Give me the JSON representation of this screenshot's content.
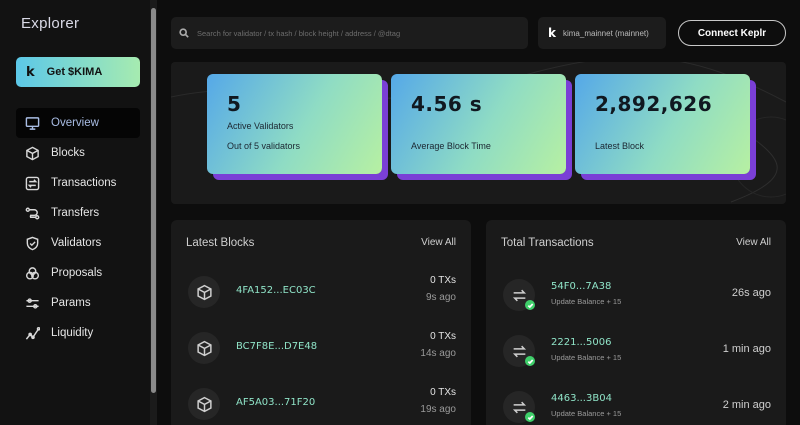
{
  "sidebar": {
    "brand": "Explorer",
    "cta_label": "Get $KIMA",
    "cta_icon": "k-logo-icon",
    "items": [
      {
        "label": "Overview",
        "icon": "monitor-icon",
        "active": true
      },
      {
        "label": "Blocks",
        "icon": "cube-icon"
      },
      {
        "label": "Transactions",
        "icon": "swap-icon"
      },
      {
        "label": "Transfers",
        "icon": "transfer-icon"
      },
      {
        "label": "Validators",
        "icon": "shield-icon"
      },
      {
        "label": "Proposals",
        "icon": "proposals-icon"
      },
      {
        "label": "Params",
        "icon": "sliders-icon"
      },
      {
        "label": "Liquidity",
        "icon": "chart-line-icon"
      }
    ]
  },
  "header": {
    "search_placeholder": "Search for validator / tx hash / block height / address / @dtag",
    "network_label": "kima_mainnet (mainnet)",
    "connect_label": "Connect Keplr"
  },
  "stats": [
    {
      "value": "5",
      "label": "Active Validators",
      "sub": "Out of 5 validators"
    },
    {
      "value": "4.56 s",
      "label": "Average Block Time"
    },
    {
      "value": "2,892,626",
      "label": "Latest Block"
    }
  ],
  "latest_blocks": {
    "title": "Latest Blocks",
    "view_all": "View All",
    "rows": [
      {
        "hash": "4FA152...EC03C",
        "txs": "0 TXs",
        "ago": "9s ago"
      },
      {
        "hash": "BC7F8E...D7E48",
        "txs": "0 TXs",
        "ago": "14s ago"
      },
      {
        "hash": "AF5A03...71F20",
        "txs": "0 TXs",
        "ago": "19s ago"
      }
    ]
  },
  "total_transactions": {
    "title": "Total Transactions",
    "view_all": "View All",
    "rows": [
      {
        "hash": "54F0...7A38",
        "sub": "Update Balance + 15",
        "ago": "26s ago"
      },
      {
        "hash": "2221...5006",
        "sub": "Update Balance + 15",
        "ago": "1 min ago"
      },
      {
        "hash": "4463...3B04",
        "sub": "Update Balance + 15",
        "ago": "2 min ago"
      }
    ]
  },
  "colors": {
    "accent_gradient_start": "#55a8e8",
    "accent_gradient_end": "#b7f0a2",
    "card_shadow": "#7a3fd6",
    "hash_color": "#8fe3c7",
    "success": "#3fcf6a"
  }
}
